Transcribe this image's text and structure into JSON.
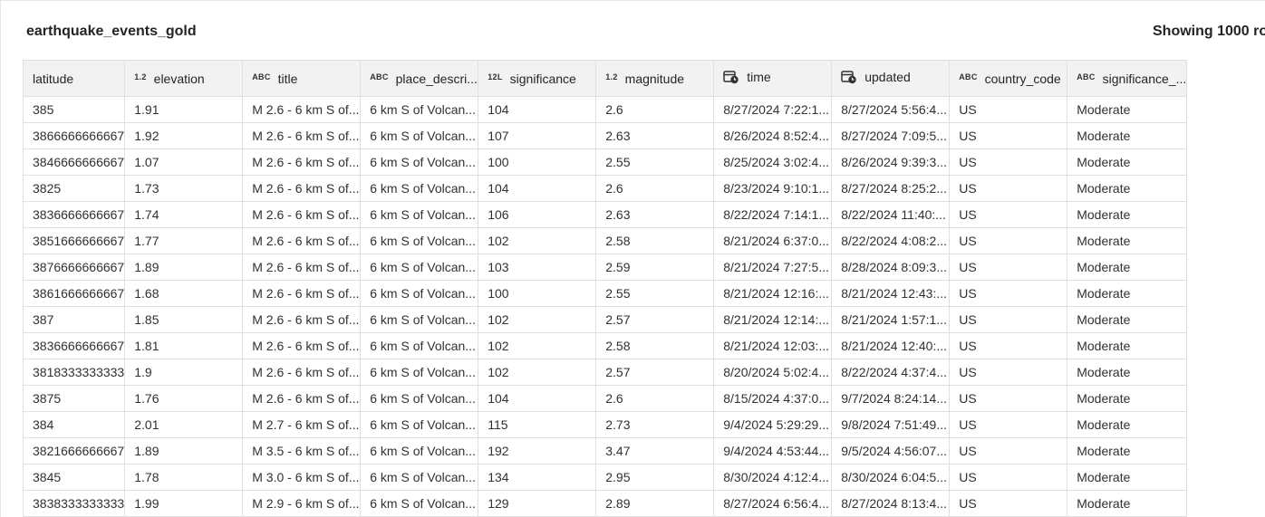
{
  "title": "earthquake_events_gold",
  "showing": "Showing 1000 ro",
  "columns": [
    {
      "type": "",
      "label": "latitude"
    },
    {
      "type": "1.2",
      "label": "elevation"
    },
    {
      "type": "ABC",
      "label": "title"
    },
    {
      "type": "ABC",
      "label": "place_descri..."
    },
    {
      "type": "12L",
      "label": "significance"
    },
    {
      "type": "1.2",
      "label": "magnitude"
    },
    {
      "type": "clock",
      "label": "time"
    },
    {
      "type": "clock",
      "label": "updated"
    },
    {
      "type": "ABC",
      "label": "country_code"
    },
    {
      "type": "ABC",
      "label": "significance_..."
    }
  ],
  "rows": [
    [
      "385",
      "1.91",
      "M 2.6 - 6 km S of...",
      "6 km S of Volcan...",
      "104",
      "2.6",
      "8/27/2024 7:22:1...",
      "8/27/2024 5:56:4...",
      "US",
      "Moderate"
    ],
    [
      "3866666666667",
      "1.92",
      "M 2.6 - 6 km S of...",
      "6 km S of Volcan...",
      "107",
      "2.63",
      "8/26/2024 8:52:4...",
      "8/27/2024 7:09:5...",
      "US",
      "Moderate"
    ],
    [
      "3846666666667",
      "1.07",
      "M 2.6 - 6 km S of...",
      "6 km S of Volcan...",
      "100",
      "2.55",
      "8/25/2024 3:02:4...",
      "8/26/2024 9:39:3...",
      "US",
      "Moderate"
    ],
    [
      "3825",
      "1.73",
      "M 2.6 - 6 km S of...",
      "6 km S of Volcan...",
      "104",
      "2.6",
      "8/23/2024 9:10:1...",
      "8/27/2024 8:25:2...",
      "US",
      "Moderate"
    ],
    [
      "3836666666667",
      "1.74",
      "M 2.6 - 6 km S of...",
      "6 km S of Volcan...",
      "106",
      "2.63",
      "8/22/2024 7:14:1...",
      "8/22/2024 11:40:...",
      "US",
      "Moderate"
    ],
    [
      "3851666666667",
      "1.77",
      "M 2.6 - 6 km S of...",
      "6 km S of Volcan...",
      "102",
      "2.58",
      "8/21/2024 6:37:0...",
      "8/22/2024 4:08:2...",
      "US",
      "Moderate"
    ],
    [
      "3876666666667",
      "1.89",
      "M 2.6 - 6 km S of...",
      "6 km S of Volcan...",
      "103",
      "2.59",
      "8/21/2024 7:27:5...",
      "8/28/2024 8:09:3...",
      "US",
      "Moderate"
    ],
    [
      "3861666666667",
      "1.68",
      "M 2.6 - 6 km S of...",
      "6 km S of Volcan...",
      "100",
      "2.55",
      "8/21/2024 12:16:...",
      "8/21/2024 12:43:...",
      "US",
      "Moderate"
    ],
    [
      "387",
      "1.85",
      "M 2.6 - 6 km S of...",
      "6 km S of Volcan...",
      "102",
      "2.57",
      "8/21/2024 12:14:...",
      "8/21/2024 1:57:1...",
      "US",
      "Moderate"
    ],
    [
      "3836666666667",
      "1.81",
      "M 2.6 - 6 km S of...",
      "6 km S of Volcan...",
      "102",
      "2.58",
      "8/21/2024 12:03:...",
      "8/21/2024 12:40:...",
      "US",
      "Moderate"
    ],
    [
      "3818333333333",
      "1.9",
      "M 2.6 - 6 km S of...",
      "6 km S of Volcan...",
      "102",
      "2.57",
      "8/20/2024 5:02:4...",
      "8/22/2024 4:37:4...",
      "US",
      "Moderate"
    ],
    [
      "3875",
      "1.76",
      "M 2.6 - 6 km S of...",
      "6 km S of Volcan...",
      "104",
      "2.6",
      "8/15/2024 4:37:0...",
      "9/7/2024 8:24:14...",
      "US",
      "Moderate"
    ],
    [
      "384",
      "2.01",
      "M 2.7 - 6 km S of...",
      "6 km S of Volcan...",
      "115",
      "2.73",
      "9/4/2024 5:29:29...",
      "9/8/2024 7:51:49...",
      "US",
      "Moderate"
    ],
    [
      "3821666666667",
      "1.89",
      "M 3.5 - 6 km S of...",
      "6 km S of Volcan...",
      "192",
      "3.47",
      "9/4/2024 4:53:44...",
      "9/5/2024 4:56:07...",
      "US",
      "Moderate"
    ],
    [
      "3845",
      "1.78",
      "M 3.0 - 6 km S of...",
      "6 km S of Volcan...",
      "134",
      "2.95",
      "8/30/2024 4:12:4...",
      "8/30/2024 6:04:5...",
      "US",
      "Moderate"
    ],
    [
      "3838333333333",
      "1.99",
      "M 2.9 - 6 km S of...",
      "6 km S of Volcan...",
      "129",
      "2.89",
      "8/27/2024 6:56:4...",
      "8/27/2024 8:13:4...",
      "US",
      "Moderate"
    ]
  ]
}
